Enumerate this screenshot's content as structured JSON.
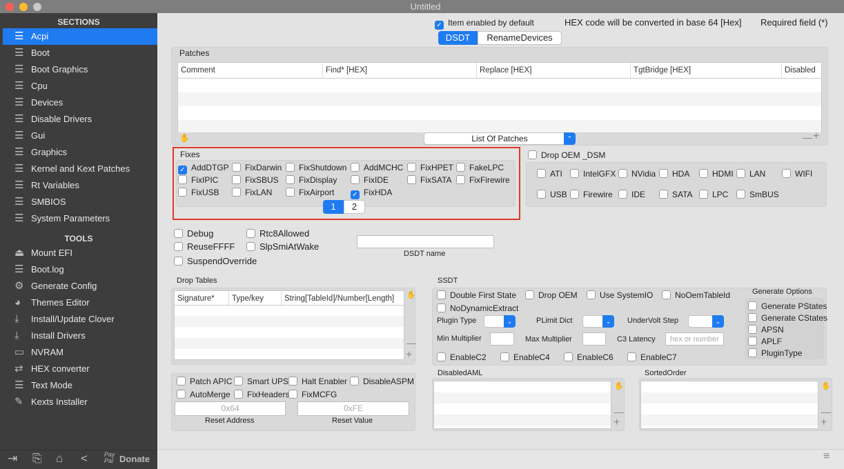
{
  "window": {
    "title": "Untitled"
  },
  "sidebar": {
    "sections_header": "SECTIONS",
    "sections": [
      "Acpi",
      "Boot",
      "Boot Graphics",
      "Cpu",
      "Devices",
      "Disable Drivers",
      "Gui",
      "Graphics",
      "Kernel and Kext Patches",
      "Rt Variables",
      "SMBIOS",
      "System Parameters"
    ],
    "tools_header": "TOOLS",
    "tools": [
      "Mount EFI",
      "Boot.log",
      "Generate Config",
      "Themes Editor",
      "Install/Update Clover",
      "Install Drivers",
      "NVRAM",
      "HEX converter",
      "Text Mode",
      "Kexts Installer"
    ],
    "donate": "Donate",
    "paypal": "Pay Pal"
  },
  "header": {
    "item_enabled": "Item enabled by default",
    "hex_note": "HEX code will be converted in base 64 [Hex]",
    "required": "Required field (*)",
    "tabs": [
      "DSDT",
      "RenameDevices"
    ]
  },
  "patches": {
    "label": "Patches",
    "columns": [
      "Comment",
      "Find* [HEX]",
      "Replace [HEX]",
      "TgtBridge [HEX]",
      "Disabled"
    ],
    "popup": "List Of Patches"
  },
  "fixes": {
    "label": "Fixes",
    "items": [
      {
        "label": "AddDTGP",
        "checked": true
      },
      {
        "label": "FixDarwin",
        "checked": false
      },
      {
        "label": "FixShutdown",
        "checked": false
      },
      {
        "label": "AddMCHC",
        "checked": false
      },
      {
        "label": "FixHPET",
        "checked": false
      },
      {
        "label": "FakeLPC",
        "checked": false
      },
      {
        "label": "FixIPIC",
        "checked": false
      },
      {
        "label": "FixSBUS",
        "checked": false
      },
      {
        "label": "FixDisplay",
        "checked": false
      },
      {
        "label": "FixIDE",
        "checked": false
      },
      {
        "label": "FixSATA",
        "checked": false
      },
      {
        "label": "FixFirewire",
        "checked": false
      },
      {
        "label": "FixUSB",
        "checked": false
      },
      {
        "label": "FixLAN",
        "checked": false
      },
      {
        "label": "FixAirport",
        "checked": false
      },
      {
        "label": "FixHDA",
        "checked": true
      }
    ],
    "pages": [
      "1",
      "2"
    ],
    "current_page": "1"
  },
  "drop_oem": {
    "label": "Drop OEM _DSM",
    "items": [
      "ATI",
      "IntelGFX",
      "NVidia",
      "HDA",
      "HDMI",
      "LAN",
      "WIFI",
      "USB",
      "Firewire",
      "IDE",
      "SATA",
      "LPC",
      "SmBUS"
    ]
  },
  "options": {
    "items": [
      "Debug",
      "Rtc8Allowed",
      "ReuseFFFF",
      "SlpSmiAtWake",
      "SuspendOverride"
    ],
    "dsdt_name_label": "DSDT name",
    "dsdt_name_value": ""
  },
  "drop_tables": {
    "label": "Drop Tables",
    "columns": [
      "Signature*",
      "Type/key",
      "String[TableId]/Number[Length]"
    ]
  },
  "ssdt": {
    "label": "SSDT",
    "checks": [
      "Double First State",
      "Drop OEM",
      "Use SystemIO",
      "NoOemTableId",
      "NoDynamicExtract"
    ],
    "plugin_type": "Plugin Type",
    "plimit_dict": "PLimit Dict",
    "undervolt": "UnderVolt Step",
    "min_mult": "Min Multiplier",
    "max_mult": "Max Multiplier",
    "c3_latency": "C3 Latency",
    "c3_placeholder": "hex or number",
    "enable": [
      "EnableC2",
      "EnableC4",
      "EnableC6",
      "EnableC7"
    ],
    "generate_label": "Generate Options",
    "generate": [
      "Generate PStates",
      "Generate CStates",
      "APSN",
      "APLF",
      "PluginType"
    ]
  },
  "misc": {
    "items": [
      "Patch APIC",
      "Smart UPS",
      "Halt Enabler",
      "DisableASPM",
      "AutoMerge",
      "FixHeaders",
      "FixMCFG"
    ],
    "reset_address_placeholder": "0x64",
    "reset_value_placeholder": "0xFE",
    "reset_address": "Reset Address",
    "reset_value": "Reset Value"
  },
  "disabled_aml": {
    "label": "DisabledAML"
  },
  "sorted_order": {
    "label": "SortedOrder"
  }
}
